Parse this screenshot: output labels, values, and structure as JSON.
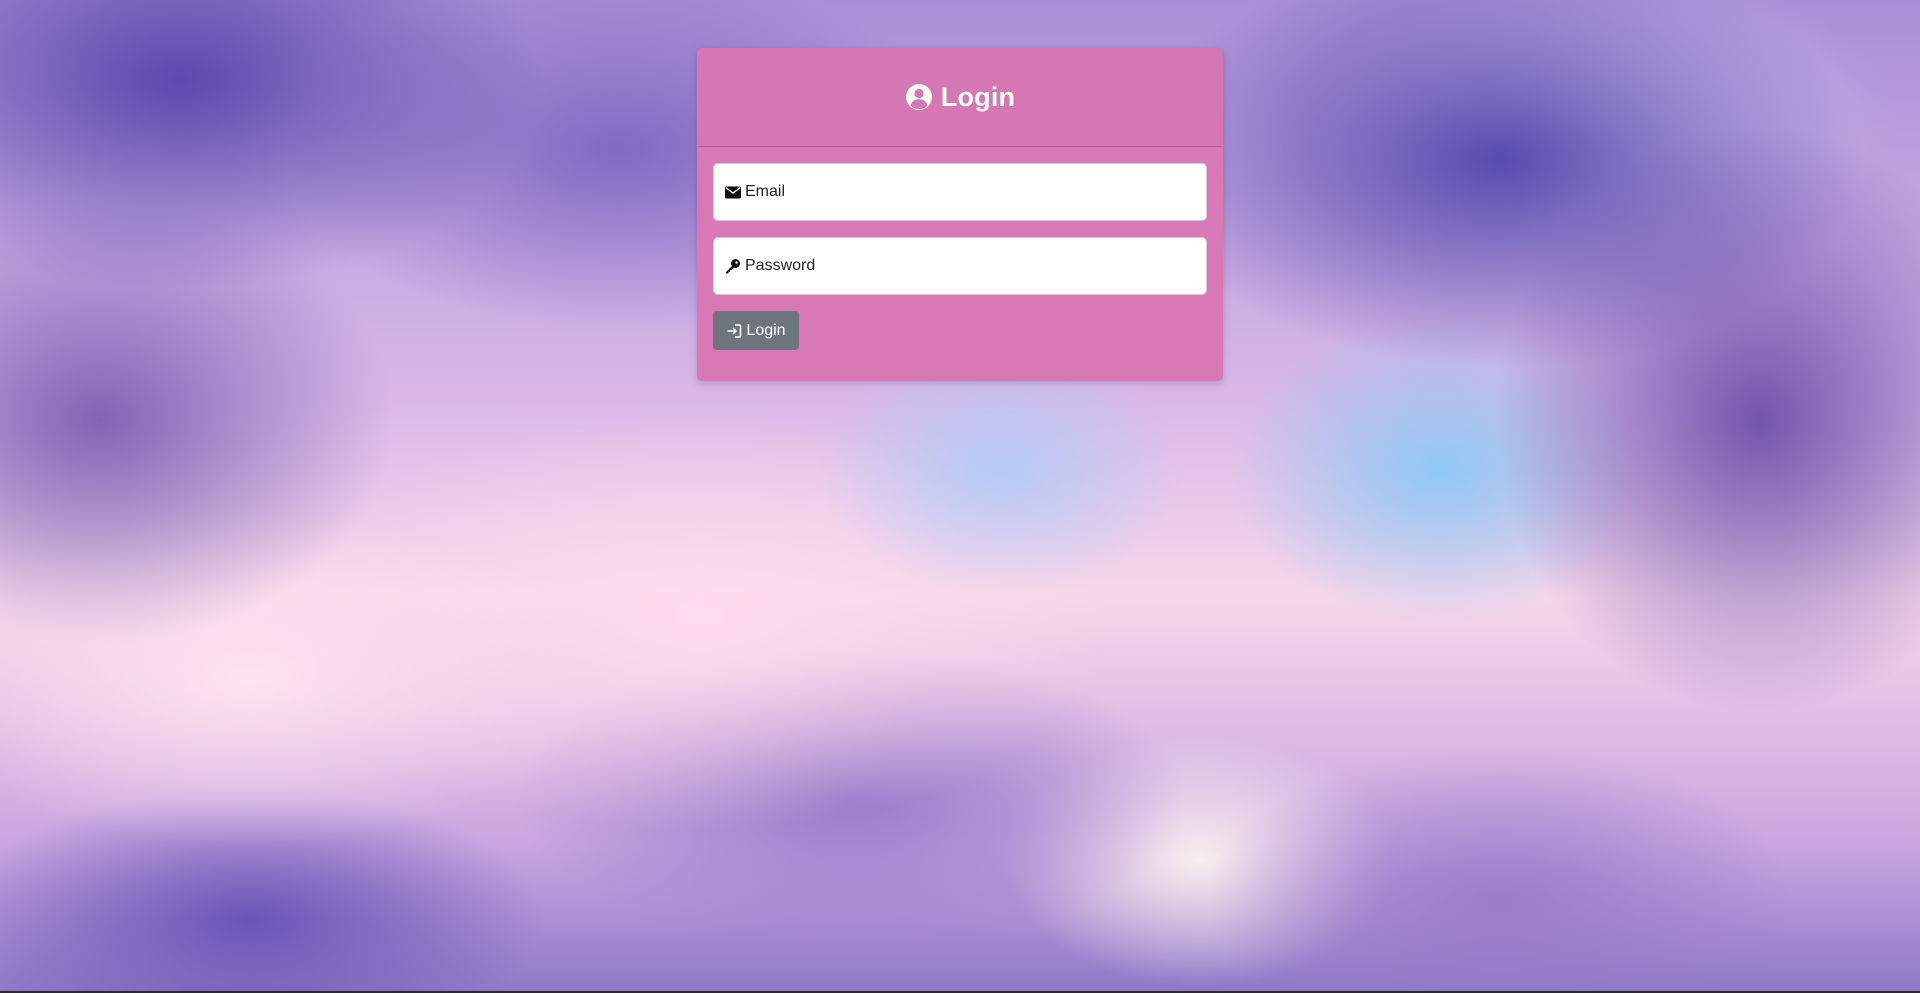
{
  "card": {
    "title": "Login",
    "header_icon": "user-circle-icon"
  },
  "form": {
    "email": {
      "placeholder": "Email",
      "icon": "envelope-icon"
    },
    "password": {
      "placeholder": "Password",
      "icon": "key-icon"
    },
    "submit": {
      "label": "Login",
      "icon": "sign-in-icon"
    }
  },
  "colors": {
    "card_background": "#d878b4",
    "button_background": "#6c757d",
    "text_on_card": "#ffffff"
  }
}
